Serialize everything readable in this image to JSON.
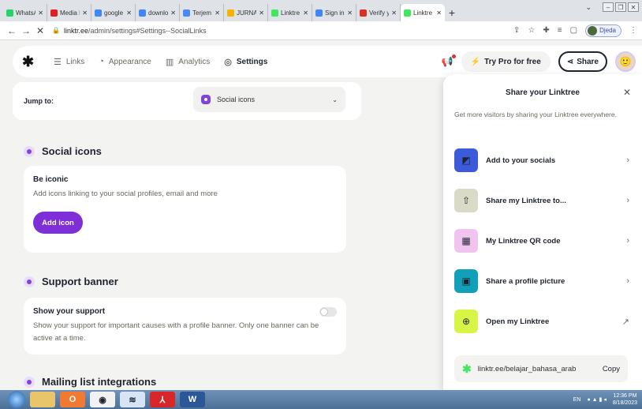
{
  "browser": {
    "tabs": [
      {
        "label": "WhatsA",
        "color": "#25d366"
      },
      {
        "label": "Media I",
        "color": "#e02020"
      },
      {
        "label": "google",
        "color": "#4285f4"
      },
      {
        "label": "downlo",
        "color": "#4285f4"
      },
      {
        "label": "Terjem",
        "color": "#4a8af4"
      },
      {
        "label": "JURNAI",
        "color": "#f4b400"
      },
      {
        "label": "Linktre",
        "color": "#43e660"
      },
      {
        "label": "Sign in",
        "color": "#4285f4"
      },
      {
        "label": "Verify y",
        "color": "#d93025"
      },
      {
        "label": "Linktre",
        "color": "#43e660"
      }
    ],
    "url_host": "linktr.ee",
    "url_path": "/admin/settings#Settings--SocialLinks",
    "profile_name": "Djeda"
  },
  "header": {
    "logo": "✱",
    "nav": [
      {
        "label": "Links",
        "icon": "list-icon"
      },
      {
        "label": "Appearance",
        "icon": "shapes-icon"
      },
      {
        "label": "Analytics",
        "icon": "bar-chart-icon"
      },
      {
        "label": "Settings",
        "icon": "gear-icon"
      }
    ],
    "try_pro": "Try Pro for free",
    "share": "Share"
  },
  "jump": {
    "label": "Jump to:",
    "selected": "Social icons"
  },
  "sections": {
    "social": {
      "title": "Social icons",
      "card_title": "Be iconic",
      "card_text": "Add icons linking to your social profiles, email and more",
      "button": "Add icon"
    },
    "support": {
      "title": "Support banner",
      "card_title": "Show your support",
      "card_text": "Show your support for important causes with a profile banner. Only one banner can be active at a time.",
      "toggle_on": false
    },
    "mailing": {
      "title": "Mailing list integrations"
    }
  },
  "share_panel": {
    "title": "Share your Linktree",
    "subtitle": "Get more visitors by sharing your Linktree everywhere.",
    "items": [
      {
        "label": "Add to your socials",
        "icon": "socials-collage-icon",
        "bg": "#3b5bdb"
      },
      {
        "label": "Share my Linktree to...",
        "icon": "share-upload-icon",
        "bg": "#d9dbc7"
      },
      {
        "label": "My Linktree QR code",
        "icon": "qr-code-icon",
        "bg": "#f1c4f0"
      },
      {
        "label": "Share a profile picture",
        "icon": "image-icon",
        "bg": "#12a0b8"
      },
      {
        "label": "Open my Linktree",
        "icon": "globe-icon",
        "bg": "#d6f545"
      }
    ],
    "link": "linktr.ee/belajar_bahasa_arab",
    "copy": "Copy"
  },
  "taskbar": {
    "lang": "EN",
    "time": "12:36 PM",
    "date": "8/18/2023"
  }
}
